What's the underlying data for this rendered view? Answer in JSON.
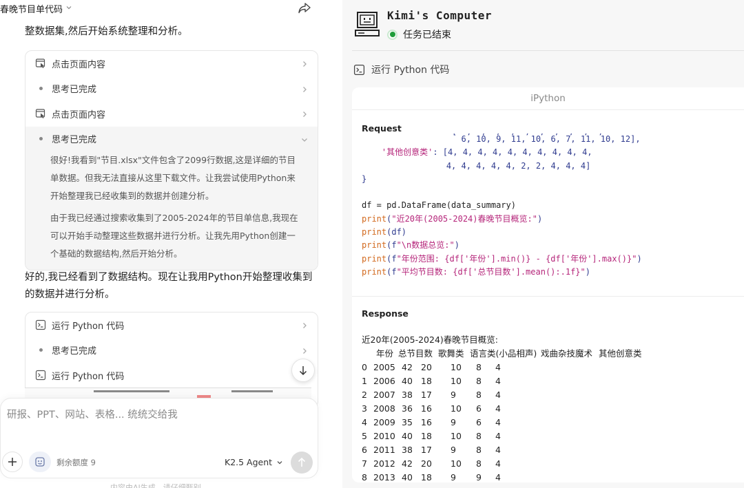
{
  "left": {
    "chat_title": "春晚节目单代码",
    "intro_text": "整数据集,然后开始系统整理和分析。",
    "card1": {
      "rows": [
        {
          "label": "点击页面内容",
          "icon": "browser-click-icon"
        },
        {
          "label": "思考已完成",
          "icon": "dot-icon"
        },
        {
          "label": "点击页面内容",
          "icon": "browser-click-icon"
        },
        {
          "label": "思考已完成",
          "icon": "dot-icon"
        }
      ],
      "thought_p1": "很好!我看到\"节目.xlsx\"文件包含了2099行数据,这是详细的节目单数据。但我无法直接从这里下载文件。让我尝试使用Python来开始整理我已经收集到的数据并创建分析。",
      "thought_p2": "由于我已经通过搜索收集到了2005-2024年的节目单信息,我现在可以开始手动整理这些数据并进行分析。让我先用Python创建一个基础的数据结构,然后开始分析。"
    },
    "middle_text": "好的,我已经看到了数据结构。现在让我用Python开始整理收集到的数据并进行分析。",
    "card2": {
      "rows": [
        {
          "label": "运行 Python 代码",
          "icon": "terminal-icon"
        },
        {
          "label": "思考已完成",
          "icon": "dot-icon"
        },
        {
          "label": "运行 Python 代码",
          "icon": "terminal-icon"
        }
      ]
    },
    "composer": {
      "placeholder": "研报、PPT、网站、表格... 统统交给我",
      "quota": "剩余额度 9",
      "agent": "K2.5 Agent"
    },
    "footer_note": "内容由AI生成，请仔细甄别"
  },
  "right": {
    "computer_name": "Kimi's Computer",
    "status": "任务已结束",
    "tool_label": "运行 Python 代码",
    "ipython_title": "iPython",
    "request_label": "Request",
    "response_label": "Response",
    "code_lines": [
      "                    6, 10, 9, 11, 10, 6, 7, 11, 10, 12],",
      "    '其他创意类': [4, 4, 4, 4, 4, 4, 4, 4, 4, 4,",
      "                 4, 4, 4, 4, 4, 2, 2, 4, 4, 4]",
      "}",
      "",
      "df = pd.DataFrame(data_summary)",
      "print(\"近20年(2005-2024)春晚节目概览:\")",
      "print(df)",
      "print(f\"\\n数据总览:\")",
      "print(f\"年份范围: {df['年份'].min()} - {df['年份'].max()}\")",
      "print(f\"平均节目数: {df['总节目数'].mean():.1f}\")"
    ],
    "response_title": "近20年(2005-2024)春晚节目概览:",
    "table_headers": [
      "年份",
      "总节目数",
      "歌舞类",
      "语言类(小品相声)",
      "戏曲杂技魔术",
      "其他创意类"
    ],
    "table_rows": [
      [
        "0",
        "2005",
        "42",
        "20",
        "10",
        "8",
        "4"
      ],
      [
        "1",
        "2006",
        "40",
        "18",
        "10",
        "8",
        "4"
      ],
      [
        "2",
        "2007",
        "38",
        "17",
        "9",
        "8",
        "4"
      ],
      [
        "3",
        "2008",
        "36",
        "16",
        "10",
        "6",
        "4"
      ],
      [
        "4",
        "2009",
        "35",
        "16",
        "9",
        "6",
        "4"
      ],
      [
        "5",
        "2010",
        "40",
        "18",
        "10",
        "8",
        "4"
      ],
      [
        "6",
        "2011",
        "38",
        "17",
        "9",
        "8",
        "4"
      ],
      [
        "7",
        "2012",
        "42",
        "20",
        "10",
        "8",
        "4"
      ],
      [
        "8",
        "2013",
        "40",
        "18",
        "9",
        "9",
        "4"
      ]
    ]
  }
}
